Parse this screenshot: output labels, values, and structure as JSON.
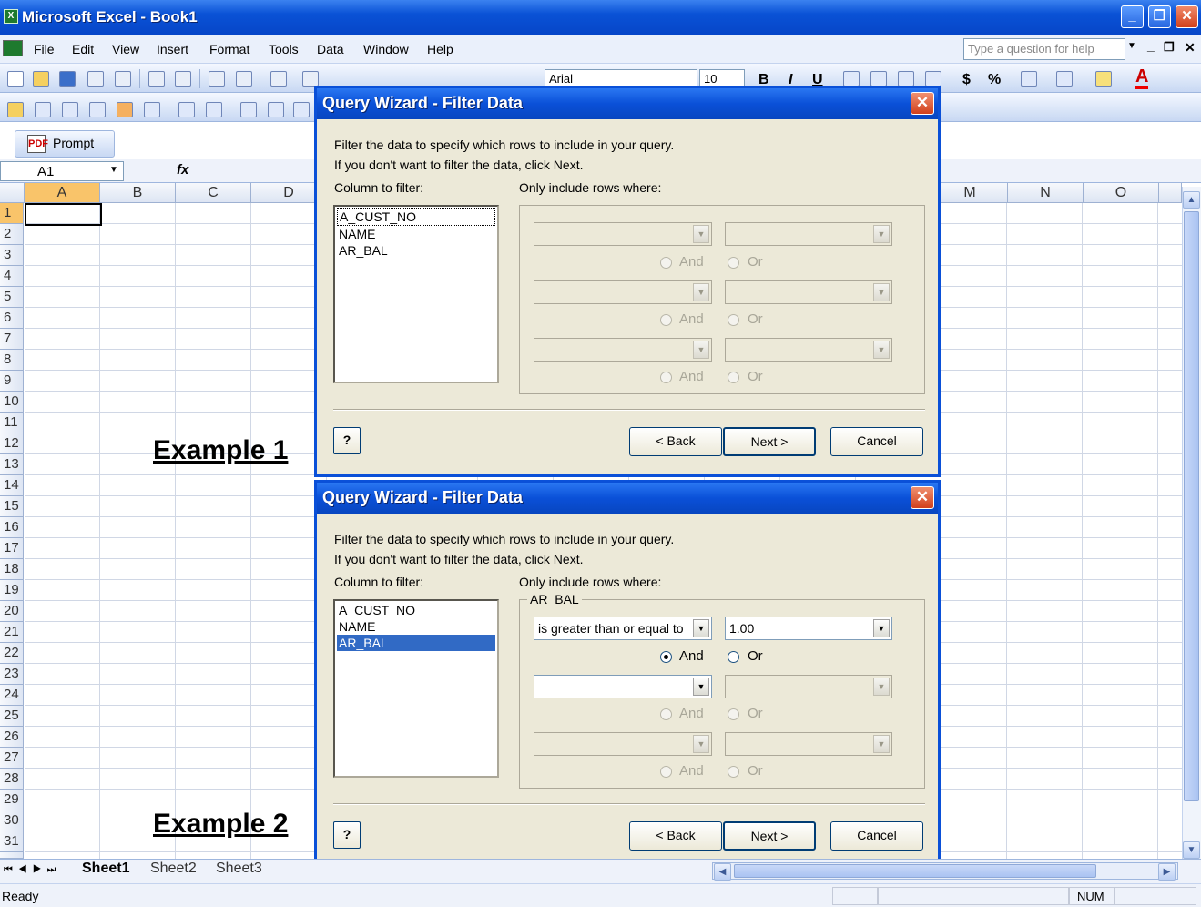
{
  "window": {
    "title": "Microsoft Excel - Book1",
    "app_icon": "X"
  },
  "menu": [
    "File",
    "Edit",
    "View",
    "Insert",
    "Format",
    "Tools",
    "Data",
    "Window",
    "Help"
  ],
  "help_box": "Type a question for help",
  "toolbar": {
    "font": "Arial",
    "size": "10",
    "bold": "B",
    "italic": "I",
    "underline": "U",
    "currency": "$",
    "percent": "%"
  },
  "prompt_bar": {
    "label": "Prompt"
  },
  "formula_bar": {
    "name_box": "A1",
    "fx": "fx"
  },
  "columns": [
    "A",
    "B",
    "C",
    "D",
    "M",
    "N",
    "O"
  ],
  "rows": [
    "1",
    "2",
    "3",
    "4",
    "5",
    "6",
    "7",
    "8",
    "9",
    "10",
    "11",
    "12",
    "13",
    "14",
    "15",
    "16",
    "17",
    "18",
    "19",
    "20",
    "21",
    "22",
    "23",
    "24",
    "25",
    "26",
    "27",
    "28",
    "29",
    "30",
    "31"
  ],
  "labels": {
    "example1": "Example 1",
    "example2": "Example 2"
  },
  "sheets": [
    "Sheet1",
    "Sheet2",
    "Sheet3"
  ],
  "status": {
    "ready": "Ready",
    "num": "NUM"
  },
  "dialog": {
    "title": "Query Wizard - Filter Data",
    "intro_line1": "Filter the data to specify which rows to include in your query.",
    "intro_line2": "If you don't want to filter the data, click Next.",
    "column_label": "Column to filter:",
    "rows_label": "Only include rows where:",
    "columns": [
      "A_CUST_NO",
      "NAME",
      "AR_BAL"
    ],
    "and_label": "And",
    "or_label": "Or",
    "back": "< Back",
    "next": "Next >",
    "cancel": "Cancel",
    "help": "?"
  },
  "dialog2": {
    "group_title": "AR_BAL",
    "operator": "is greater than or equal to",
    "value": "1.00"
  }
}
